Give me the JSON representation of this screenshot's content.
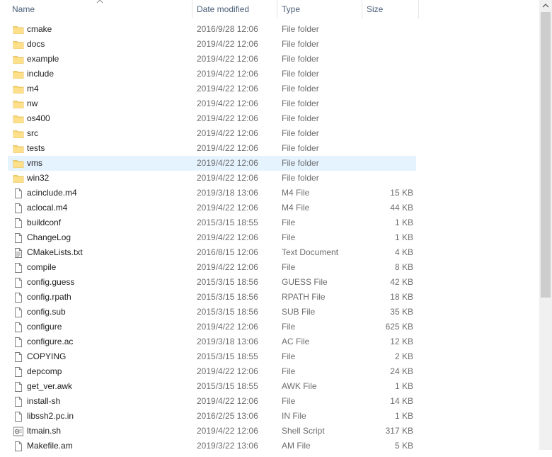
{
  "columns": {
    "name": "Name",
    "date_modified": "Date modified",
    "type": "Type",
    "size": "Size"
  },
  "sort": {
    "column": "name",
    "direction": "ascending",
    "icon": "sort-up-icon"
  },
  "selected_row": "vms",
  "colors": {
    "folder": "#f8d775",
    "selection": "#e5f3ff",
    "header_text": "#4c607a",
    "secondary_text": "#6d6d6d"
  },
  "files": [
    {
      "name": "cmake",
      "date": "2016/9/28 12:06",
      "type": "File folder",
      "size": "",
      "icon": "folder-icon"
    },
    {
      "name": "docs",
      "date": "2019/4/22 12:06",
      "type": "File folder",
      "size": "",
      "icon": "folder-icon"
    },
    {
      "name": "example",
      "date": "2019/4/22 12:06",
      "type": "File folder",
      "size": "",
      "icon": "folder-icon"
    },
    {
      "name": "include",
      "date": "2019/4/22 12:06",
      "type": "File folder",
      "size": "",
      "icon": "folder-icon"
    },
    {
      "name": "m4",
      "date": "2019/4/22 12:06",
      "type": "File folder",
      "size": "",
      "icon": "folder-icon"
    },
    {
      "name": "nw",
      "date": "2019/4/22 12:06",
      "type": "File folder",
      "size": "",
      "icon": "folder-icon"
    },
    {
      "name": "os400",
      "date": "2019/4/22 12:06",
      "type": "File folder",
      "size": "",
      "icon": "folder-icon"
    },
    {
      "name": "src",
      "date": "2019/4/22 12:06",
      "type": "File folder",
      "size": "",
      "icon": "folder-icon"
    },
    {
      "name": "tests",
      "date": "2019/4/22 12:06",
      "type": "File folder",
      "size": "",
      "icon": "folder-icon"
    },
    {
      "name": "vms",
      "date": "2019/4/22 12:06",
      "type": "File folder",
      "size": "",
      "icon": "folder-icon"
    },
    {
      "name": "win32",
      "date": "2019/4/22 12:06",
      "type": "File folder",
      "size": "",
      "icon": "folder-icon"
    },
    {
      "name": "acinclude.m4",
      "date": "2019/3/18 13:06",
      "type": "M4 File",
      "size": "15 KB",
      "icon": "file-icon"
    },
    {
      "name": "aclocal.m4",
      "date": "2019/4/22 12:06",
      "type": "M4 File",
      "size": "44 KB",
      "icon": "file-icon"
    },
    {
      "name": "buildconf",
      "date": "2015/3/15 18:55",
      "type": "File",
      "size": "1 KB",
      "icon": "file-icon"
    },
    {
      "name": "ChangeLog",
      "date": "2019/4/22 12:06",
      "type": "File",
      "size": "1 KB",
      "icon": "file-icon"
    },
    {
      "name": "CMakeLists.txt",
      "date": "2016/8/15 12:06",
      "type": "Text Document",
      "size": "4 KB",
      "icon": "text-file-icon"
    },
    {
      "name": "compile",
      "date": "2019/4/22 12:06",
      "type": "File",
      "size": "8 KB",
      "icon": "file-icon"
    },
    {
      "name": "config.guess",
      "date": "2015/3/15 18:56",
      "type": "GUESS File",
      "size": "42 KB",
      "icon": "file-icon"
    },
    {
      "name": "config.rpath",
      "date": "2015/3/15 18:56",
      "type": "RPATH File",
      "size": "18 KB",
      "icon": "file-icon"
    },
    {
      "name": "config.sub",
      "date": "2015/3/15 18:56",
      "type": "SUB File",
      "size": "35 KB",
      "icon": "file-icon"
    },
    {
      "name": "configure",
      "date": "2019/4/22 12:06",
      "type": "File",
      "size": "625 KB",
      "icon": "file-icon"
    },
    {
      "name": "configure.ac",
      "date": "2019/3/18 13:06",
      "type": "AC File",
      "size": "12 KB",
      "icon": "file-icon"
    },
    {
      "name": "COPYING",
      "date": "2015/3/15 18:55",
      "type": "File",
      "size": "2 KB",
      "icon": "file-icon"
    },
    {
      "name": "depcomp",
      "date": "2019/4/22 12:06",
      "type": "File",
      "size": "24 KB",
      "icon": "file-icon"
    },
    {
      "name": "get_ver.awk",
      "date": "2015/3/15 18:55",
      "type": "AWK File",
      "size": "1 KB",
      "icon": "file-icon"
    },
    {
      "name": "install-sh",
      "date": "2019/4/22 12:06",
      "type": "File",
      "size": "14 KB",
      "icon": "file-icon"
    },
    {
      "name": "libssh2.pc.in",
      "date": "2016/2/25 13:06",
      "type": "IN File",
      "size": "1 KB",
      "icon": "file-icon"
    },
    {
      "name": "ltmain.sh",
      "date": "2019/4/22 12:06",
      "type": "Shell Script",
      "size": "317 KB",
      "icon": "script-file-icon"
    },
    {
      "name": "Makefile.am",
      "date": "2019/3/22 13:06",
      "type": "AM File",
      "size": "5 KB",
      "icon": "file-icon"
    }
  ]
}
